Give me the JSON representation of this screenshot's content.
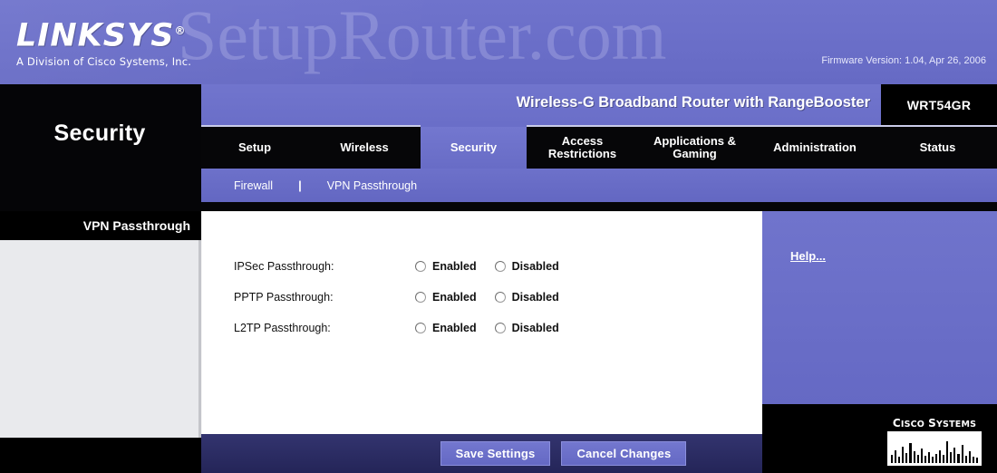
{
  "brand": {
    "logo_text": "LINKSYS",
    "logo_registered": "®",
    "tagline": "A Division of Cisco Systems, Inc.",
    "watermark": "SetupRouter.com",
    "firmware": "Firmware Version: 1.04, Apr 26, 2006",
    "accent_purple": "#6a6ec8",
    "black": "#000000"
  },
  "header": {
    "page_title": "Security",
    "product_name": "Wireless-G Broadband Router with RangeBooster",
    "model": "WRT54GR"
  },
  "tabs": [
    {
      "label": "Setup",
      "active": false
    },
    {
      "label": "Wireless",
      "active": false
    },
    {
      "label": "Security",
      "active": true
    },
    {
      "label": "Access Restrictions",
      "active": false
    },
    {
      "label": "Applications & Gaming",
      "active": false
    },
    {
      "label": "Administration",
      "active": false
    },
    {
      "label": "Status",
      "active": false
    }
  ],
  "subnav": {
    "items": [
      {
        "label": "Firewall",
        "active": false
      },
      {
        "label": "VPN Passthrough",
        "active": true
      }
    ],
    "separator": "|"
  },
  "sidebar": {
    "section_title": "VPN Passthrough"
  },
  "form": {
    "rows": [
      {
        "label": "IPSec Passthrough:",
        "options": [
          {
            "label": "Enabled",
            "checked": false
          },
          {
            "label": "Disabled",
            "checked": false
          }
        ]
      },
      {
        "label": "PPTP Passthrough:",
        "options": [
          {
            "label": "Enabled",
            "checked": false
          },
          {
            "label": "Disabled",
            "checked": false
          }
        ]
      },
      {
        "label": "L2TP Passthrough:",
        "options": [
          {
            "label": "Enabled",
            "checked": false
          },
          {
            "label": "Disabled",
            "checked": false
          }
        ]
      }
    ]
  },
  "help": {
    "link_label": "Help..."
  },
  "buttons": {
    "save": "Save Settings",
    "cancel": "Cancel Changes"
  },
  "cisco": {
    "wordmark": "Cisco Systems",
    "bars": [
      9,
      14,
      7,
      18,
      11,
      22,
      13,
      9,
      16,
      8,
      12,
      7,
      10,
      14,
      9,
      24,
      12,
      17,
      10,
      20,
      8,
      13,
      7,
      6
    ]
  }
}
